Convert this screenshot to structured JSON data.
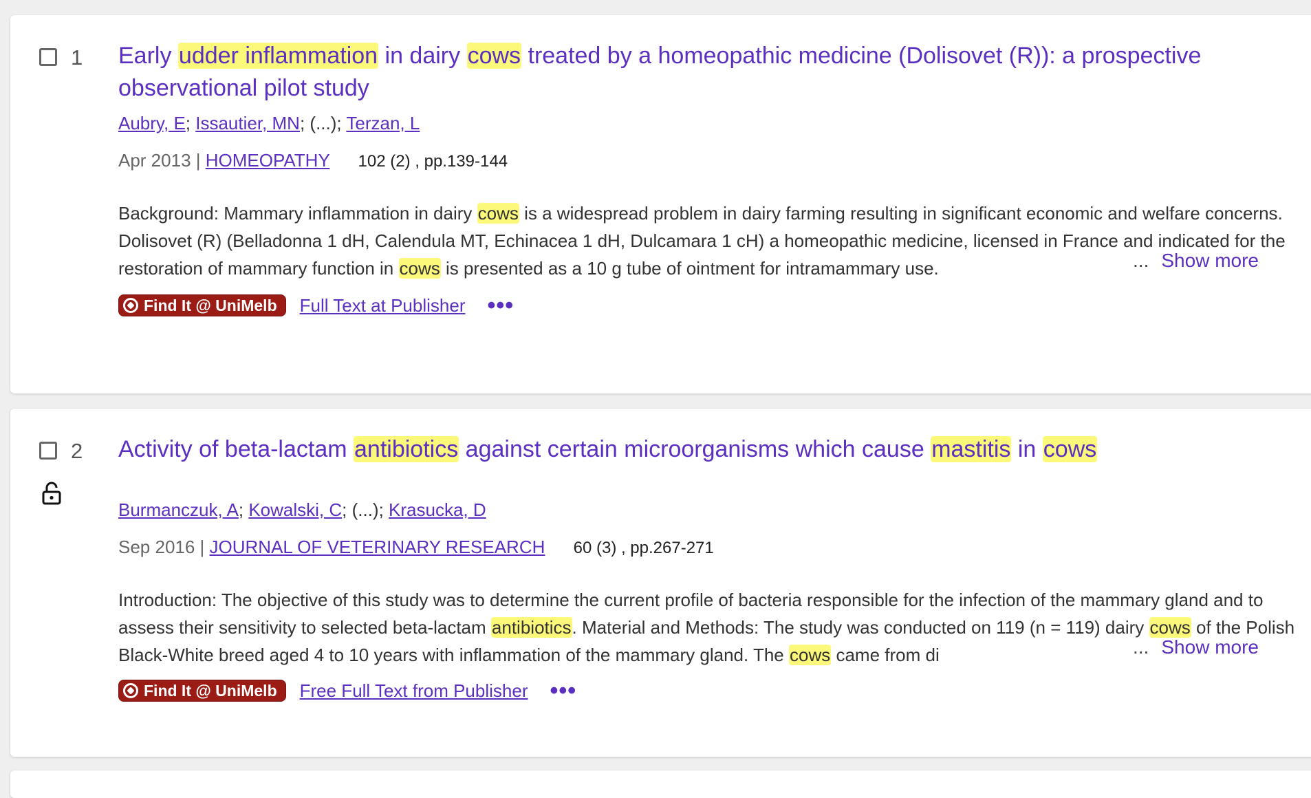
{
  "results": [
    {
      "number": "1",
      "title_parts": [
        {
          "text": "Early ",
          "hl": false
        },
        {
          "text": "udder inflammation",
          "hl": true
        },
        {
          "text": " in dairy ",
          "hl": false
        },
        {
          "text": "cows",
          "hl": true
        },
        {
          "text": " treated by a homeopathic medicine (Dolisovet (R)): a prospective observational pilot study",
          "hl": false
        }
      ],
      "authors": [
        "Aubry, E",
        "Issautier, MN",
        "Terzan, L"
      ],
      "authors_ellipsis": "(...)",
      "date": "Apr 2013",
      "journal": "HOMEOPATHY",
      "pub_details": "102 (2) , pp.139-144",
      "abstract_parts": [
        {
          "text": "Background: Mammary inflammation in dairy ",
          "hl": false
        },
        {
          "text": "cows",
          "hl": true
        },
        {
          "text": " is a widespread problem in dairy farming resulting in significant economic and welfare concerns. Dolisovet (R) (Belladonna 1 dH, Calendula MT, Echinacea 1 dH, Dulcamara 1 cH) a homeopathic medicine, licensed in France and indicated for the restoration of mammary function in ",
          "hl": false
        },
        {
          "text": "cows",
          "hl": true
        },
        {
          "text": " is presented as a 10 g tube of ointment for intramammary use.",
          "hl": false
        }
      ],
      "findit_label": "Find It @ UniMelb",
      "fulltext_label": "Full Text at Publisher",
      "open_access": false
    },
    {
      "number": "2",
      "title_parts": [
        {
          "text": "Activity of beta-lactam ",
          "hl": false
        },
        {
          "text": "antibiotics",
          "hl": true
        },
        {
          "text": " against certain microorganisms which cause ",
          "hl": false
        },
        {
          "text": "mastitis",
          "hl": true
        },
        {
          "text": " in ",
          "hl": false
        },
        {
          "text": "cows",
          "hl": true
        }
      ],
      "authors": [
        "Burmanczuk, A",
        "Kowalski, C",
        "Krasucka, D"
      ],
      "authors_ellipsis": "(...)",
      "date": "Sep 2016",
      "journal": "JOURNAL OF VETERINARY RESEARCH",
      "pub_details": "60 (3) , pp.267-271",
      "abstract_parts": [
        {
          "text": "Introduction: The objective of this study was to determine the current profile of bacteria responsible for the infection of the mammary gland and to assess their sensitivity to selected beta-lactam ",
          "hl": false
        },
        {
          "text": "antibiotics",
          "hl": true
        },
        {
          "text": ". Material and Methods: The study was conducted on 119 (n = 119) dairy ",
          "hl": false
        },
        {
          "text": "cows",
          "hl": true
        },
        {
          "text": " of the Polish Black-White breed aged 4 to 10 years with inflammation of the mammary gland. The ",
          "hl": false
        },
        {
          "text": "cows",
          "hl": true
        },
        {
          "text": " came from di",
          "hl": false
        }
      ],
      "findit_label": "Find It @ UniMelb",
      "fulltext_label": "Free Full Text from Publisher",
      "open_access": true
    }
  ],
  "show_more": {
    "ellipsis": "...",
    "label": "Show more"
  },
  "more_actions": "•••",
  "colors": {
    "link": "#5b2fc0",
    "highlight": "#fcf87a",
    "findit_bg": "#9b1b15"
  },
  "icons": {
    "open_access": "unlock-icon",
    "findit": "findit-logo-icon"
  }
}
